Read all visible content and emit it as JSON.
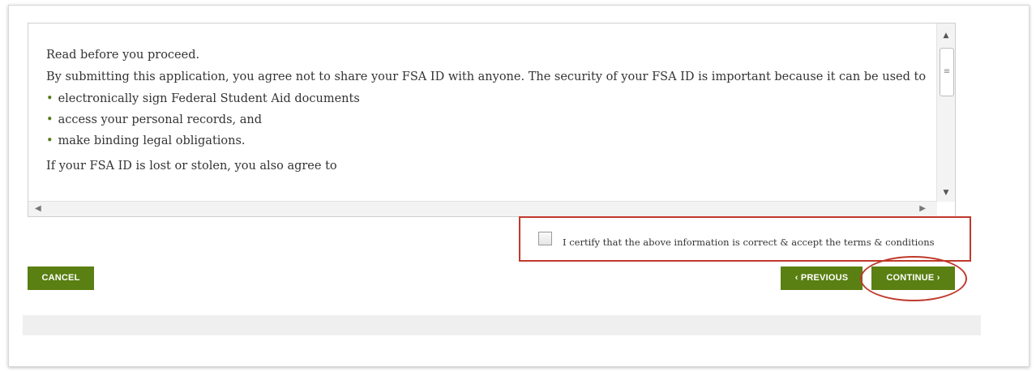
{
  "terms": {
    "heading": "Read before you proceed.",
    "intro": "By submitting this application, you agree not to share your FSA ID with anyone. The security of your FSA ID is important because it can be used to",
    "items": [
      "electronically sign Federal Student Aid documents",
      "access your personal records, and",
      "make binding legal obligations."
    ],
    "followup": "If your FSA ID is lost or stolen, you also agree to"
  },
  "certify": {
    "label": "I certify that the above information is correct & accept the terms & conditions",
    "checked": false
  },
  "buttons": {
    "cancel": "CANCEL",
    "previous": "‹ PREVIOUS",
    "continue": "CONTINUE ›"
  },
  "colors": {
    "button": "#5a7f12",
    "highlight": "#c0392b"
  }
}
